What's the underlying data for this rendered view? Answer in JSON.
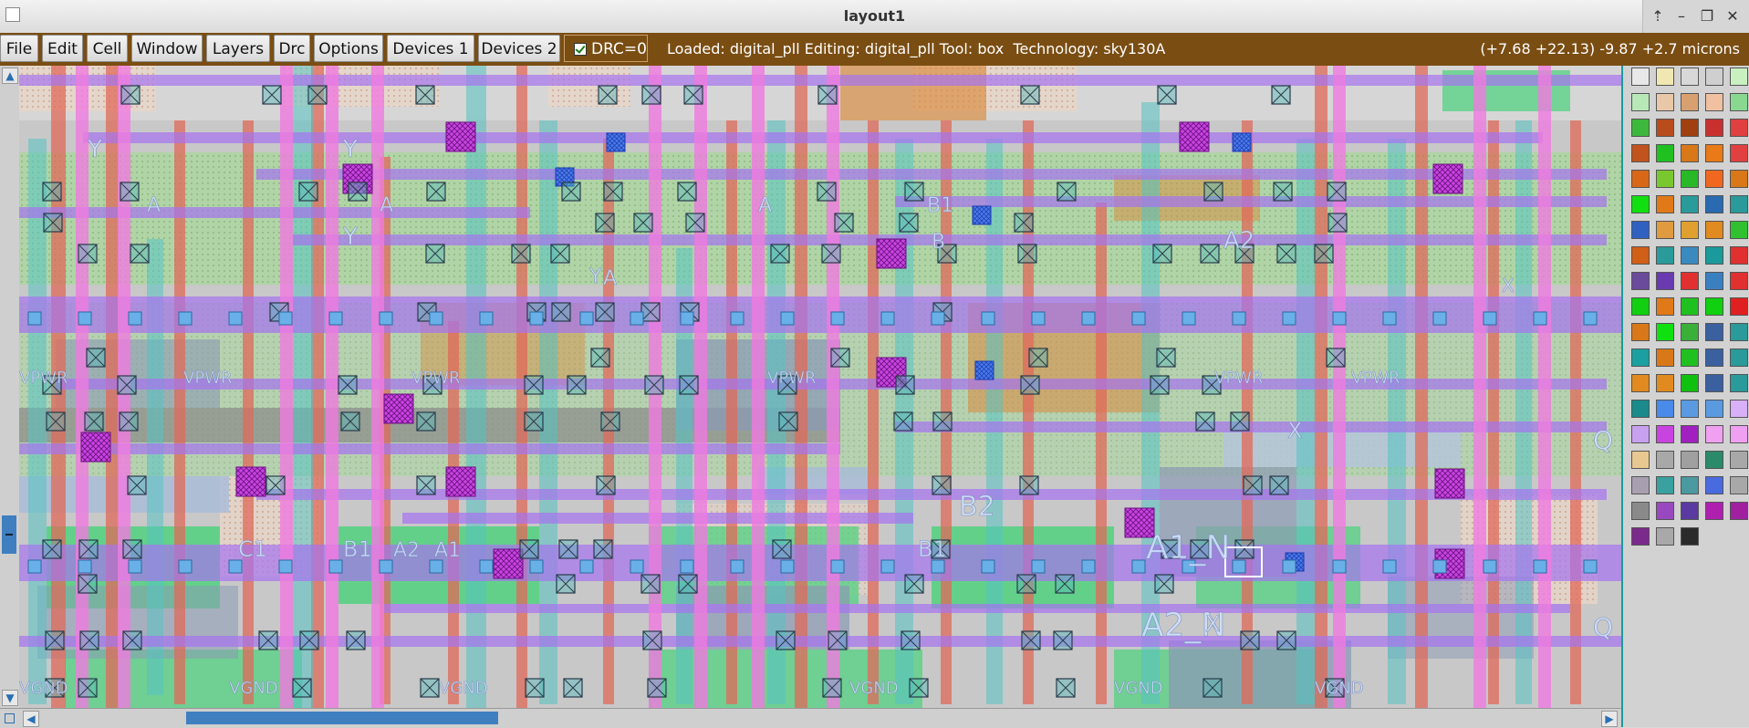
{
  "window": {
    "title": "layout1"
  },
  "menubar": {
    "items": [
      "File",
      "Edit",
      "Cell",
      "Window",
      "Layers",
      "Drc",
      "Options",
      "Devices 1",
      "Devices 2"
    ],
    "drc_label": "DRC=0",
    "drc_checked": true,
    "status": "Loaded: digital_pll Editing: digital_pll Tool: box  Technology: sky130A",
    "coords": "(+7.68 +22.13) -9.87 +2.7 microns",
    "bg_color": "#7a4d12"
  },
  "canvas": {
    "labels": [
      "Y",
      "A",
      "Y",
      "A",
      "Y",
      "A",
      "B1",
      "A",
      "A2",
      "B",
      "Y",
      "X",
      "VPWR",
      "VPWR",
      "VPWR",
      "VPWR",
      "VPWR",
      "VPWR",
      "X",
      "B2",
      "C1",
      "B1",
      "A2",
      "A1",
      "B1",
      "A1_N",
      "A2_N",
      "X",
      "VGND",
      "VGND",
      "VGND",
      "VGND",
      "VGND",
      "VGND",
      "Q",
      "Q"
    ]
  },
  "scrollbars": {
    "vertical": "vertical-scrollbar",
    "horizontal": "horizontal-scrollbar"
  },
  "palette": {
    "name": "layer-palette"
  }
}
